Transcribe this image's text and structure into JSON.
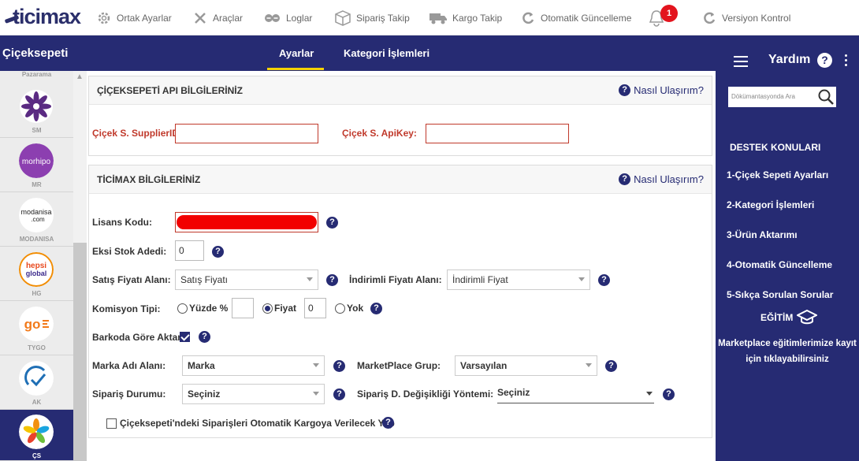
{
  "brand": {
    "logo_text": "ticimax"
  },
  "top_nav": [
    {
      "label": "Ortak Ayarlar",
      "icon": "gear-icon"
    },
    {
      "label": "Araçlar",
      "icon": "tools-icon"
    },
    {
      "label": "Loglar",
      "icon": "log-icon"
    },
    {
      "label": "Sipariş Takip",
      "icon": "box-icon"
    },
    {
      "label": "Kargo Takip",
      "icon": "truck-icon"
    },
    {
      "label": "Otomatik Güncelleme",
      "icon": "refresh-icon"
    },
    {
      "label": "Versiyon Kontrol",
      "icon": "refresh-icon"
    }
  ],
  "notifications": {
    "count": "1"
  },
  "header": {
    "title": "Çiçeksepeti",
    "tabs": [
      {
        "label": "Ayarlar",
        "active": true
      },
      {
        "label": "Kategori İşlemleri",
        "active": false
      }
    ]
  },
  "marketplaces": {
    "top_label": "Pazarama",
    "items": [
      {
        "label": "SM"
      },
      {
        "label": "MR"
      },
      {
        "label": "MODANISA"
      },
      {
        "label": "HG"
      },
      {
        "label": "TYGO"
      },
      {
        "label": "AK"
      },
      {
        "label": "ÇS",
        "active": true
      }
    ]
  },
  "api_panel": {
    "title": "ÇİÇEKSEPETİ API BİLGİLERİNİZ",
    "help_label": "Nasıl Ulaşırım?",
    "supplier_label": "Çiçek S. SupplierID:",
    "supplier_value": "",
    "apikey_label": "Çiçek S. ApiKey:",
    "apikey_value": ""
  },
  "ticimax_panel": {
    "title": "TİCİMAX BİLGİLERİNİZ",
    "help_label": "Nasıl Ulaşırım?",
    "license_label": "Lisans Kodu:",
    "stock_label": "Eksi Stok Adedi:",
    "stock_value": "0",
    "sale_price_label": "Satış Fiyatı Alanı:",
    "sale_price_value": "Satış Fiyatı",
    "discount_price_label": "İndirimli Fiyatı Alanı:",
    "discount_price_value": "İndirimli Fiyat",
    "commission_label": "Komisyon Tipi:",
    "commission_options": [
      "Yüzde %",
      "Fiyat",
      "Yok"
    ],
    "commission_selected": "Fiyat",
    "commission_percent_value": "",
    "commission_price_value": "0",
    "barcode_label": "Barkoda Göre Aktar",
    "barcode_checked": true,
    "brand_field_label": "Marka Adı Alanı:",
    "brand_field_value": "Marka",
    "marketplace_group_label": "MarketPlace Grup:",
    "marketplace_group_value": "Varsayılan",
    "order_status_label": "Sipariş Durumu:",
    "order_status_value": "Seçiniz",
    "order_change_label": "Sipariş D. Değişikliği Yöntemi:",
    "order_change_value": "Seçiniz",
    "auto_cargo_label": "Çiçeksepeti'ndeki Siparişleri Otomatik Kargoya Verilecek Yap",
    "auto_cargo_checked": false
  },
  "help": {
    "title": "Yardım",
    "search_placeholder": "Dökümantasyonda Ara",
    "section_title": "DESTEK KONULARI",
    "topics": [
      "1-Çiçek Sepeti Ayarları",
      "2-Kategori İşlemleri",
      "3-Ürün Aktarımı",
      "4-Otomatik Güncelleme",
      "5-Sıkça Sorulan Sorular"
    ],
    "education_title": "EĞİTİM",
    "education_text_1": "Marketplace eğitimlerimize kayıt",
    "education_text_2": "için tıklayabilirsiniz"
  },
  "colors": {
    "navy": "#262b73",
    "accent": "#f5d200",
    "error": "#c0392b",
    "badge": "#e3141e"
  }
}
